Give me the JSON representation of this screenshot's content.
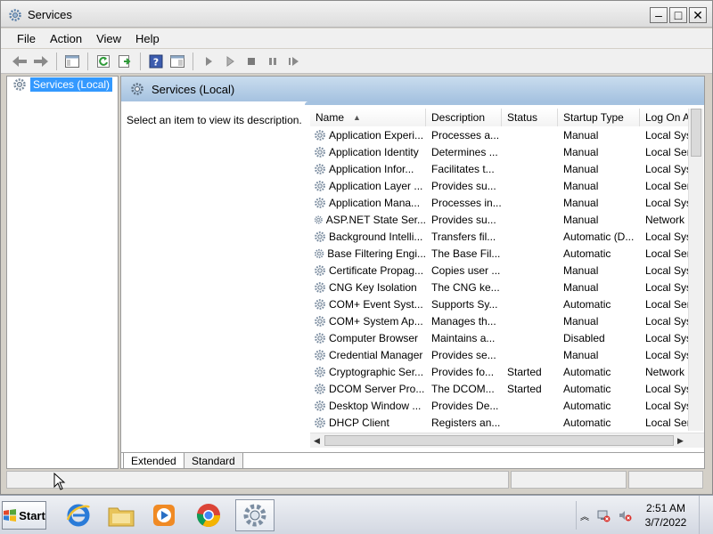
{
  "window": {
    "title": "Services",
    "min_symbol": "–",
    "max_symbol": "□",
    "close_symbol": "✕"
  },
  "menu": [
    "File",
    "Action",
    "View",
    "Help"
  ],
  "tree": {
    "root_label": "Services (Local)"
  },
  "right_pane": {
    "header_title": "Services (Local)",
    "description_prompt": "Select an item to view its description."
  },
  "columns": [
    "Name",
    "Description",
    "Status",
    "Startup Type",
    "Log On A"
  ],
  "services": [
    {
      "name": "Application Experi...",
      "description": "Processes a...",
      "status": "",
      "startup": "Manual",
      "logon": "Local Syst"
    },
    {
      "name": "Application Identity",
      "description": "Determines ...",
      "status": "",
      "startup": "Manual",
      "logon": "Local Serv"
    },
    {
      "name": "Application Infor...",
      "description": "Facilitates t...",
      "status": "",
      "startup": "Manual",
      "logon": "Local Syst"
    },
    {
      "name": "Application Layer ...",
      "description": "Provides su...",
      "status": "",
      "startup": "Manual",
      "logon": "Local Serv"
    },
    {
      "name": "Application Mana...",
      "description": "Processes in...",
      "status": "",
      "startup": "Manual",
      "logon": "Local Syst"
    },
    {
      "name": "ASP.NET State Ser...",
      "description": "Provides su...",
      "status": "",
      "startup": "Manual",
      "logon": "Network S"
    },
    {
      "name": "Background Intelli...",
      "description": "Transfers fil...",
      "status": "",
      "startup": "Automatic (D...",
      "logon": "Local Syst"
    },
    {
      "name": "Base Filtering Engi...",
      "description": "The Base Fil...",
      "status": "",
      "startup": "Automatic",
      "logon": "Local Serv"
    },
    {
      "name": "Certificate Propag...",
      "description": "Copies user ...",
      "status": "",
      "startup": "Manual",
      "logon": "Local Syst"
    },
    {
      "name": "CNG Key Isolation",
      "description": "The CNG ke...",
      "status": "",
      "startup": "Manual",
      "logon": "Local Syst"
    },
    {
      "name": "COM+ Event Syst...",
      "description": "Supports Sy...",
      "status": "",
      "startup": "Automatic",
      "logon": "Local Serv"
    },
    {
      "name": "COM+ System Ap...",
      "description": "Manages th...",
      "status": "",
      "startup": "Manual",
      "logon": "Local Syst"
    },
    {
      "name": "Computer Browser",
      "description": "Maintains a...",
      "status": "",
      "startup": "Disabled",
      "logon": "Local Syst"
    },
    {
      "name": "Credential Manager",
      "description": "Provides se...",
      "status": "",
      "startup": "Manual",
      "logon": "Local Syst"
    },
    {
      "name": "Cryptographic Ser...",
      "description": "Provides fo...",
      "status": "Started",
      "startup": "Automatic",
      "logon": "Network S"
    },
    {
      "name": "DCOM Server Pro...",
      "description": "The DCOM...",
      "status": "Started",
      "startup": "Automatic",
      "logon": "Local Syst"
    },
    {
      "name": "Desktop Window ...",
      "description": "Provides De...",
      "status": "",
      "startup": "Automatic",
      "logon": "Local Syst"
    },
    {
      "name": "DHCP Client",
      "description": "Registers an...",
      "status": "",
      "startup": "Automatic",
      "logon": "Local Serv"
    }
  ],
  "view_tabs": [
    "Extended",
    "Standard"
  ],
  "taskbar": {
    "start_label": "Start",
    "time": "2:51 AM",
    "date": "3/7/2022"
  },
  "colors": {
    "selection": "#3399ff",
    "header_band": "#a5c2e0"
  }
}
